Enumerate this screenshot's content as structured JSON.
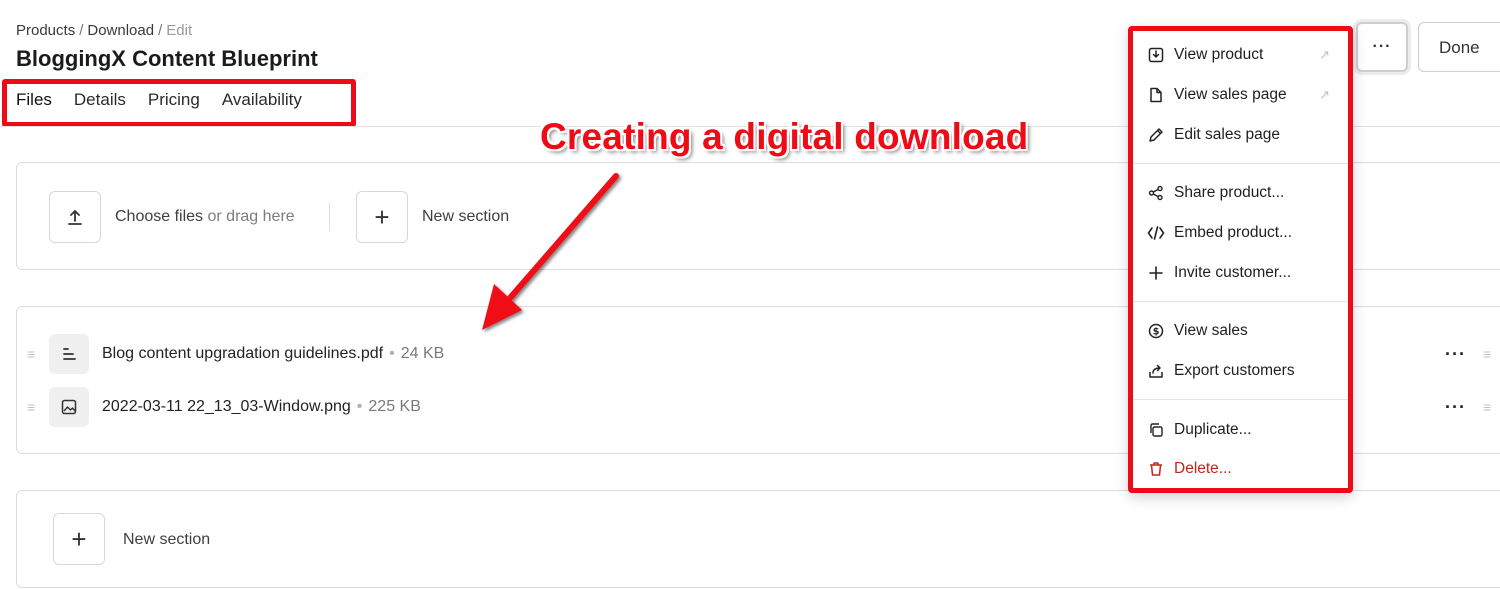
{
  "breadcrumb": {
    "products": "Products",
    "download": "Download",
    "edit": "Edit",
    "separator": "/"
  },
  "page_title": "BloggingX Content Blueprint",
  "tabs": [
    {
      "label": "Files"
    },
    {
      "label": "Details"
    },
    {
      "label": "Pricing"
    },
    {
      "label": "Availability"
    }
  ],
  "annotation": {
    "text": "Creating a digital download",
    "color": "#ef0b16"
  },
  "upload": {
    "choose_files": "Choose files",
    "or_drag": "or drag here",
    "new_section": "New section"
  },
  "files": [
    {
      "name": "Blog content upgradation guidelines.pdf",
      "size": "24 KB",
      "icon": "document-lines-icon"
    },
    {
      "name": "2022-03-11 22_13_03-Window.png",
      "size": "225 KB",
      "icon": "image-icon"
    }
  ],
  "bottom_section": {
    "new_section": "New section"
  },
  "header_actions": {
    "more": "···",
    "done": "Done"
  },
  "menu": {
    "items": {
      "view_product": "View product",
      "view_sales_page": "View sales page",
      "edit_sales_page": "Edit sales page",
      "share_product": "Share product...",
      "embed_product": "Embed product...",
      "invite_customer": "Invite customer...",
      "view_sales": "View sales",
      "export_customers": "Export customers",
      "duplicate": "Duplicate...",
      "delete": "Delete..."
    }
  },
  "colors": {
    "accent_red": "#ec0b16",
    "danger": "#c0271b"
  }
}
